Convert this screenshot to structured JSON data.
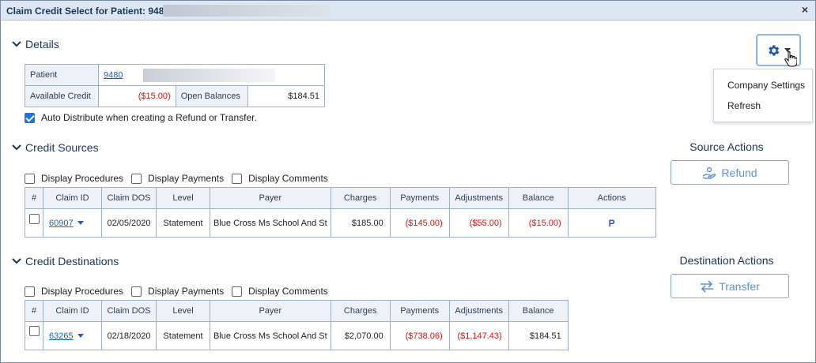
{
  "window": {
    "title": "Claim Credit Select for Patient: 9480 -",
    "close_label": "×"
  },
  "details": {
    "heading": "Details",
    "patient_label": "Patient",
    "patient_id": "9480",
    "available_credit_label": "Available Credit",
    "available_credit_value": "($15.00)",
    "open_balances_label": "Open Balances",
    "open_balances_value": "$184.51",
    "auto_distribute_label": "Auto Distribute when creating a Refund or Transfer.",
    "auto_distribute_checked": true
  },
  "settings_menu": {
    "items": [
      "Company Settings",
      "Refresh"
    ]
  },
  "credit_sources": {
    "heading": "Credit Sources",
    "options": [
      "Display Procedures",
      "Display Payments",
      "Display Comments"
    ],
    "columns": [
      "#",
      "Claim ID",
      "Claim DOS",
      "Level",
      "Payer",
      "Charges",
      "Payments",
      "Adjustments",
      "Balance",
      "Actions"
    ],
    "rows": [
      {
        "claim_id": "60907",
        "claim_dos": "02/05/2020",
        "level": "Statement",
        "payer": "Blue Cross Ms School And St",
        "charges": "$185.00",
        "payments": "($145.00)",
        "adjustments": "($55.00)",
        "balance": "($15.00)",
        "action": "P"
      }
    ]
  },
  "source_actions": {
    "heading": "Source Actions",
    "refund_label": "Refund"
  },
  "credit_destinations": {
    "heading": "Credit Destinations",
    "options": [
      "Display Procedures",
      "Display Payments",
      "Display Comments"
    ],
    "columns": [
      "#",
      "Claim ID",
      "Claim DOS",
      "Level",
      "Payer",
      "Charges",
      "Payments",
      "Adjustments",
      "Balance"
    ],
    "rows": [
      {
        "claim_id": "63265",
        "claim_dos": "02/18/2020",
        "level": "Statement",
        "payer": "Blue Cross Ms School And St",
        "charges": "$2,070.00",
        "payments": "($738.06)",
        "adjustments": "($1,147.43)",
        "balance": "$184.51"
      }
    ]
  },
  "destination_actions": {
    "heading": "Destination Actions",
    "transfer_label": "Transfer"
  },
  "colors": {
    "accent": "#1f5fbf",
    "negative": "#d11111",
    "header_bg": "#dde6f3"
  }
}
